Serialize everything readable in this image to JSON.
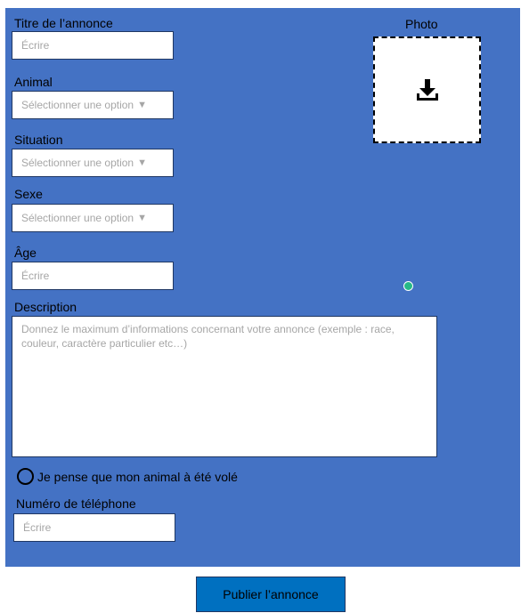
{
  "form": {
    "title": {
      "label": "Titre de l’annonce",
      "placeholder": "Écrire"
    },
    "animal": {
      "label": "Animal",
      "placeholder": "Sélectionner une option"
    },
    "situation": {
      "label": "Situation",
      "placeholder": "Sélectionner une option"
    },
    "sexe": {
      "label": "Sexe",
      "placeholder": "Sélectionner une option"
    },
    "age": {
      "label": "Âge",
      "placeholder": "Écrire"
    },
    "description": {
      "label": "Description",
      "placeholder": "Donnez le maximum d’informations concernant votre annonce (exemple : race, couleur, caractère particulier etc…)"
    },
    "stolen": {
      "label": "Je pense que mon animal à été volé",
      "checked": false
    },
    "phone": {
      "label": "Numéro de téléphone",
      "placeholder": "Écrire"
    },
    "dropdown_arrow": "▼"
  },
  "photo": {
    "label": "Photo",
    "icon": "download-icon"
  },
  "publish_button": {
    "label": "Publier l’annonce"
  },
  "colors": {
    "panel": "#4472c4",
    "publish_button": "#0070c0",
    "status_dot": "#26b987"
  }
}
